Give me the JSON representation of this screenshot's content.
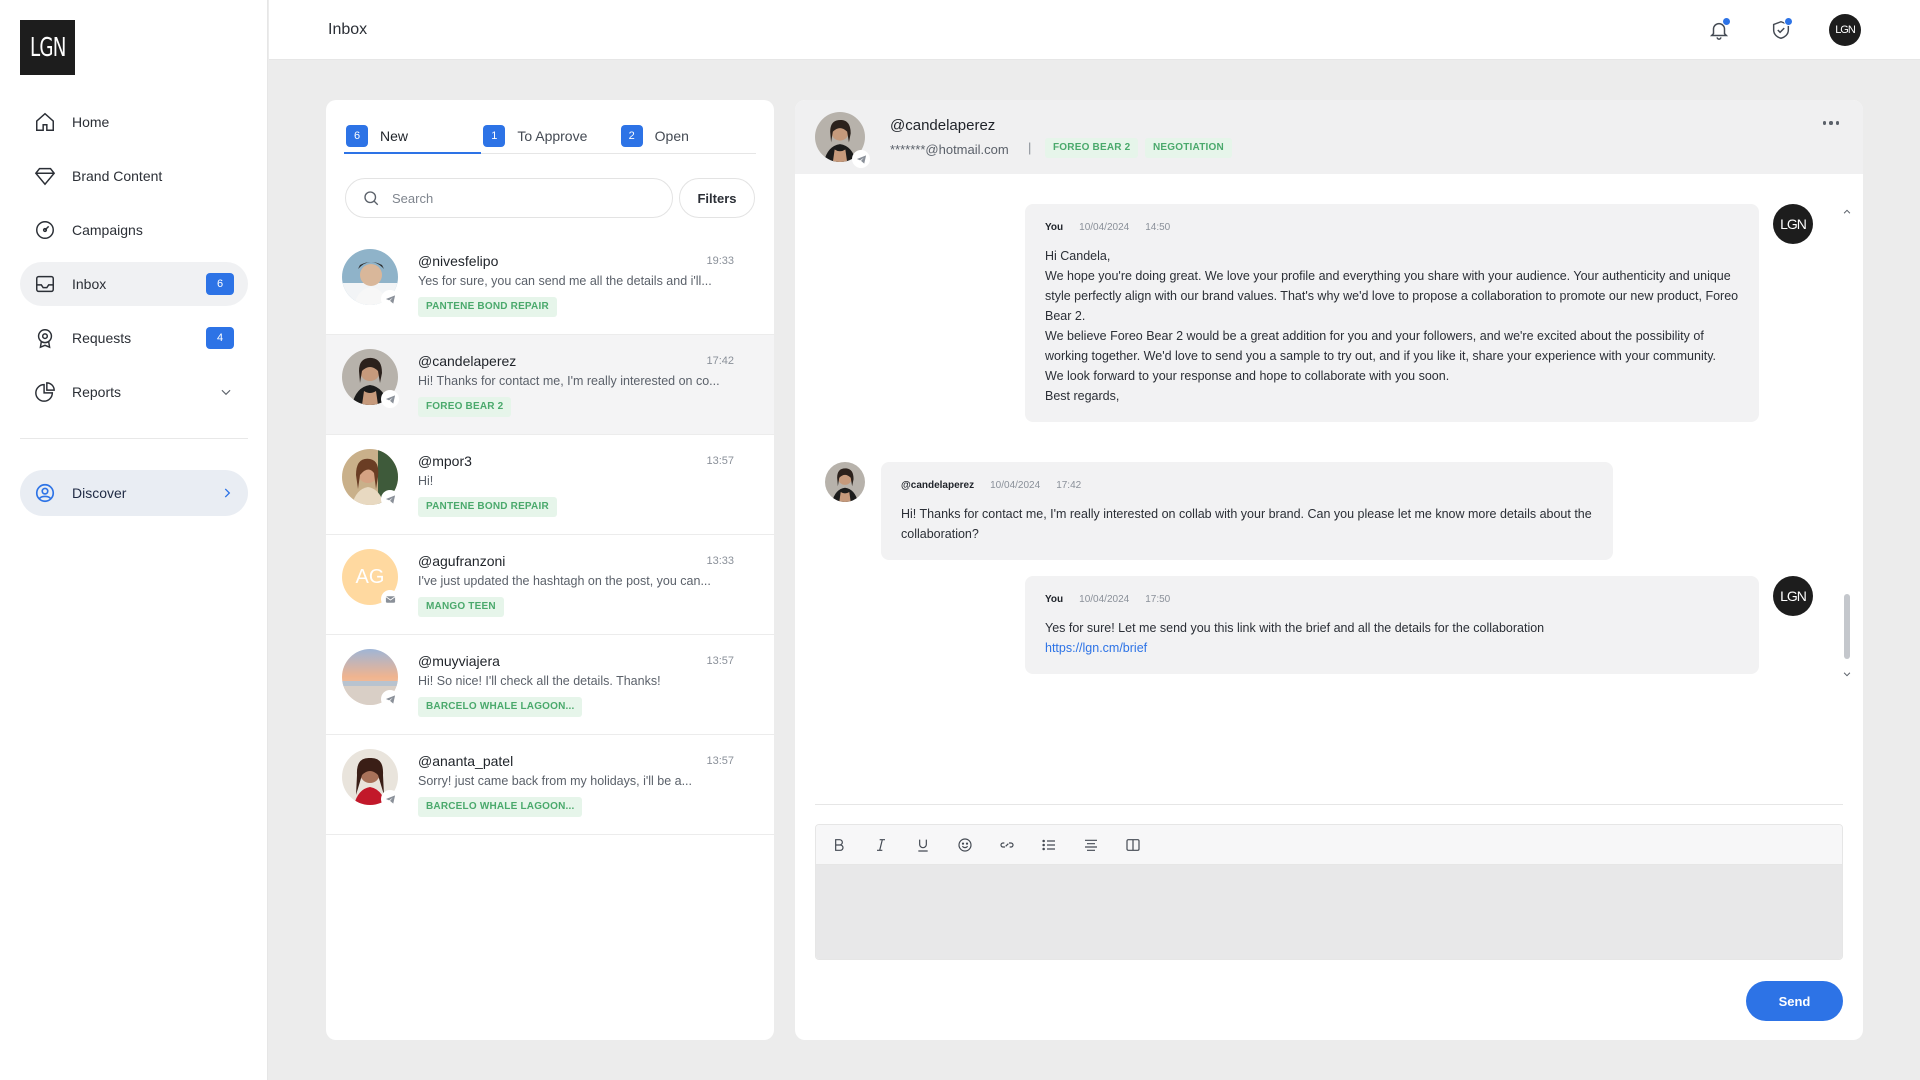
{
  "app": {
    "logo_text": "LGN"
  },
  "sidebar": {
    "items": [
      {
        "label": "Home",
        "icon": "home-icon"
      },
      {
        "label": "Brand Content",
        "icon": "diamond-icon"
      },
      {
        "label": "Campaigns",
        "icon": "gauge-icon"
      },
      {
        "label": "Inbox",
        "icon": "inbox-icon",
        "badge": "6",
        "active": true
      },
      {
        "label": "Requests",
        "icon": "badge-icon",
        "badge": "4"
      },
      {
        "label": "Reports",
        "icon": "pie-chart-icon",
        "expandable": true
      }
    ],
    "discover": {
      "label": "Discover",
      "icon": "user-circle-icon"
    }
  },
  "topbar": {
    "title": "Inbox",
    "avatar_text": "LGN"
  },
  "list": {
    "tabs": [
      {
        "count": "6",
        "label": "New",
        "active": true
      },
      {
        "count": "1",
        "label": "To Approve"
      },
      {
        "count": "2",
        "label": "Open"
      }
    ],
    "search_placeholder": "Search",
    "filters_label": "Filters",
    "conversations": [
      {
        "user": "@nivesfelipo",
        "time": "19:33",
        "preview": "Yes for sure, you can send me all the details and i'll...",
        "tag": "PANTENE BOND REPAIR",
        "channel": "telegram-icon"
      },
      {
        "user": "@candelaperez",
        "time": "17:42",
        "preview": "Hi! Thanks for contact me, I'm really interested on co...",
        "tag": "FOREO BEAR 2",
        "channel": "telegram-icon",
        "selected": true
      },
      {
        "user": "@mpor3",
        "time": "13:57",
        "preview": "Hi!",
        "tag": "PANTENE BOND REPAIR",
        "channel": "telegram-icon"
      },
      {
        "user": "@agufranzoni",
        "time": "13:33",
        "preview": "I've just updated the hashtagh on the post, you can...",
        "tag": "MANGO TEEN",
        "channel": "mail-icon",
        "initials": "AG"
      },
      {
        "user": "@muyviajera",
        "time": "13:57",
        "preview": "Hi! So nice! I'll check all the details. Thanks!",
        "tag": "BARCELO WHALE LAGOON...",
        "channel": "telegram-icon"
      },
      {
        "user": "@ananta_patel",
        "time": "13:57",
        "preview": "Sorry! just came back from my holidays, i'll be a...",
        "tag": "BARCELO WHALE LAGOON...",
        "channel": "telegram-icon"
      }
    ]
  },
  "chat": {
    "header": {
      "name": "@candelaperez",
      "email": "*******@hotmail.com",
      "separator": "|",
      "tags": [
        "FOREO BEAR 2",
        "NEGOTIATION"
      ]
    },
    "messages": [
      {
        "from": "You",
        "date": "10/04/2024",
        "time": "14:50",
        "lines": [
          "Hi Candela,",
          "We hope you're doing great. We love your profile and everything you share with your audience. Your authenticity and unique style perfectly align with our brand values. That's why we'd love to propose a collaboration to promote our new product, Foreo Bear 2.",
          "We believe Foreo Bear 2 would be a great addition for you and your followers, and we're excited about the possibility of working together. We'd love to send you a sample to try out, and if you like it, share your experience with your community.",
          "We look forward to your response and hope to collaborate with you soon.",
          "Best regards,"
        ]
      },
      {
        "from": "@candelaperez",
        "date": "10/04/2024",
        "time": "17:42",
        "lines": [
          "Hi! Thanks for contact me, I'm really interested on collab with your brand. Can you please let me know more details about the collaboration?"
        ]
      },
      {
        "from": "You",
        "date": "10/04/2024",
        "time": "17:50",
        "lines": [
          "Yes for sure! Let me send you this link with the brief and all the details for the collaboration"
        ],
        "link": "https://lgn.cm/brief"
      }
    ],
    "avatar_text": "LGN",
    "send_label": "Send"
  },
  "colors": {
    "accent": "#2d73e6",
    "tag_text": "#4aa96c",
    "tag_bg": "#e6f5ea"
  }
}
